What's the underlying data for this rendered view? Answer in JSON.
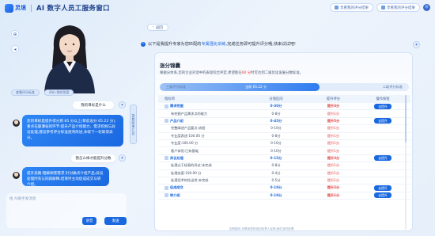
{
  "header": {
    "logo_text": "灵境",
    "title": "AI 数字人员工服务窗口",
    "btn1": "享看我的评分结果",
    "btn2": "享看我的评分结果"
  },
  "left": {
    "tags": [
      "查看评分标准",
      "评价-我的答案"
    ],
    "vtab": "答题结果汇总",
    "messages": [
      {
        "role": "user",
        "text": "我的目标是什么"
      },
      {
        "role": "bot",
        "text": "您的目标是提升得分到 85 分以上(目前总分 65.22 分),重点在最薄弱的环节:提升产品介绍能力、需求挖掘与异议处理,建议参考评分标准逐项改进,争取下一轮取得高分。"
      },
      {
        "role": "user",
        "text": "我怎么样才能提升分数"
      },
      {
        "role": "bot",
        "text": "提升思路:理解顾客需求,针对痛点介绍产品;异议处理时先认同再解释;结束时主动促成成交与转介绍。"
      }
    ],
    "input_placeholder": "给 AI助手发消息",
    "voice_btn": "语音",
    "send_btn": "发送"
  },
  "main": {
    "back": "返回",
    "notice_pre": "以下是我提升专家为您匹配的",
    "notice_hl": "专属强化训练",
    "notice_post": ",完成任务即可提升评分哦,快来试试吧!",
    "panel_title": "涨分锦囊",
    "panel_desc_pre": "根据分体系,您的企业对话中的表现综合评定,希望能在",
    "panel_desc_hl": "60 分",
    "panel_desc_post": "时可达到二级优化发展分数标准。",
    "score_left": "三级评分标准",
    "score_mid": "当前 65.22 分",
    "score_right": "二级评分标准",
    "score_fraction": 0.64,
    "columns": [
      "指标项",
      "分值区间",
      "提升评分",
      "操作按钮"
    ],
    "rows": [
      {
        "type": "sec",
        "name": "需求挖掘",
        "range": "0-30分",
        "gain": "提升3分",
        "btn": "去提升"
      },
      {
        "type": "sub",
        "name": "有挖掘产品需求点的能力",
        "range": "0-8分",
        "gain": "提升1分",
        "btn": ""
      },
      {
        "type": "sec",
        "name": "产品介绍",
        "range": "0-45分",
        "gain": "提升5分",
        "btn": "去提升"
      },
      {
        "type": "sub",
        "name": "完整阐述产品要点:流程",
        "range": "0-10分",
        "gain": "提升1分",
        "btn": ""
      },
      {
        "type": "sub",
        "name": "专业度表述:100.00 分",
        "range": "0-8分",
        "gain": "提升1分",
        "btn": ""
      },
      {
        "type": "sub",
        "name": "专业度:100.00 分",
        "range": "0-10分",
        "gain": "提升1分",
        "btn": ""
      },
      {
        "type": "sub",
        "name": "客户体验:已有基础",
        "range": "0-10分",
        "gain": "提升1分",
        "btn": ""
      },
      {
        "type": "sec",
        "name": "异议处理",
        "range": "0-15分",
        "gain": "提升3分",
        "btn": "去提升"
      },
      {
        "type": "sub",
        "name": "处理过于轻易的异议:未完成",
        "range": "0-8分",
        "gain": "提升1分",
        "btn": ""
      },
      {
        "type": "sub",
        "name": "处理态度:100.00 分",
        "range": "0-4分",
        "gain": "提升1分",
        "btn": ""
      },
      {
        "type": "sub",
        "name": "处理话术的恰当性:未完成",
        "range": "0-5分",
        "gain": "提升1分",
        "btn": ""
      },
      {
        "type": "sec",
        "name": "促成成交",
        "range": "0-10分",
        "gain": "提升2分",
        "btn": "去提升"
      },
      {
        "type": "sec",
        "name": "转介绍",
        "range": "0-10分",
        "gain": "提升1分",
        "btn": "去提升"
      }
    ],
    "footer": "如有疑问,可联系您的培训负责人反馈,我们及时处理"
  }
}
